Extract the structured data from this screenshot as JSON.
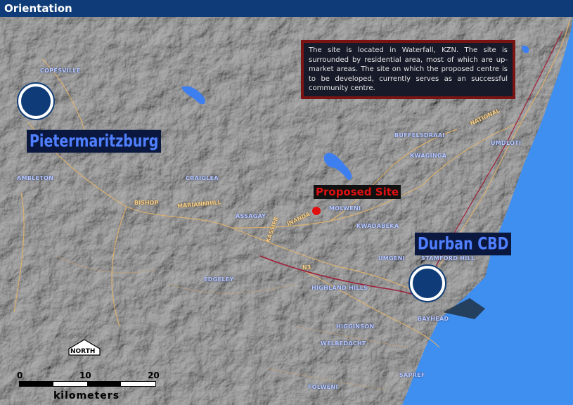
{
  "window": {
    "title": "Orientation"
  },
  "info_text": "The site is located in Waterfall, KZN. The site is surrounded by residential area, most of which are up-market areas. The site on which the proposed centre is to be developed, currently serves as an successful community centre.",
  "cities": {
    "pietermaritzburg": "Pietermaritzburg",
    "durban": "Durban CBD"
  },
  "proposed_site": "Proposed Site",
  "places": {
    "copesville": "COPESVILLE",
    "ambleton": "AMBLETON",
    "craiglea": "CRAIGLEA",
    "assagay": "ASSAGAY",
    "molweni": "MOLWENI",
    "kwadabeka": "KWADABEKA",
    "buffelsdraai": "BUFFELSDRAAI",
    "kwaginga": "KWAGINGA",
    "umdloti": "UMDLOTI",
    "edgeley": "EDGELEY",
    "highland_hills": "HIGHLAND HILLS",
    "umgeni": "UMGENI",
    "stamford_hill": "STAMFORD HILL",
    "bayhead": "BAYHEAD",
    "higginson": "HIGGINSON",
    "welbedacht": "WELBEDACHT",
    "sapref": "SAPREF",
    "folweni": "FOLWENI"
  },
  "roads": {
    "bishop": "BISHOP",
    "mariannhill": "MARIANNHILL",
    "inanda": "INANDA",
    "national": "NATIONAL",
    "kassier": "KASSIER",
    "n3": "N3"
  },
  "north_label": "NORTH",
  "scale": {
    "tick0": "0",
    "tick1": "10",
    "tick2": "20",
    "units": "kilometers"
  },
  "colors": {
    "title_bar": "#0f3c78",
    "ocean": "#3f8ff0",
    "road": "#e3b36a",
    "info_border": "#7a1414",
    "site_marker": "#e01010"
  }
}
